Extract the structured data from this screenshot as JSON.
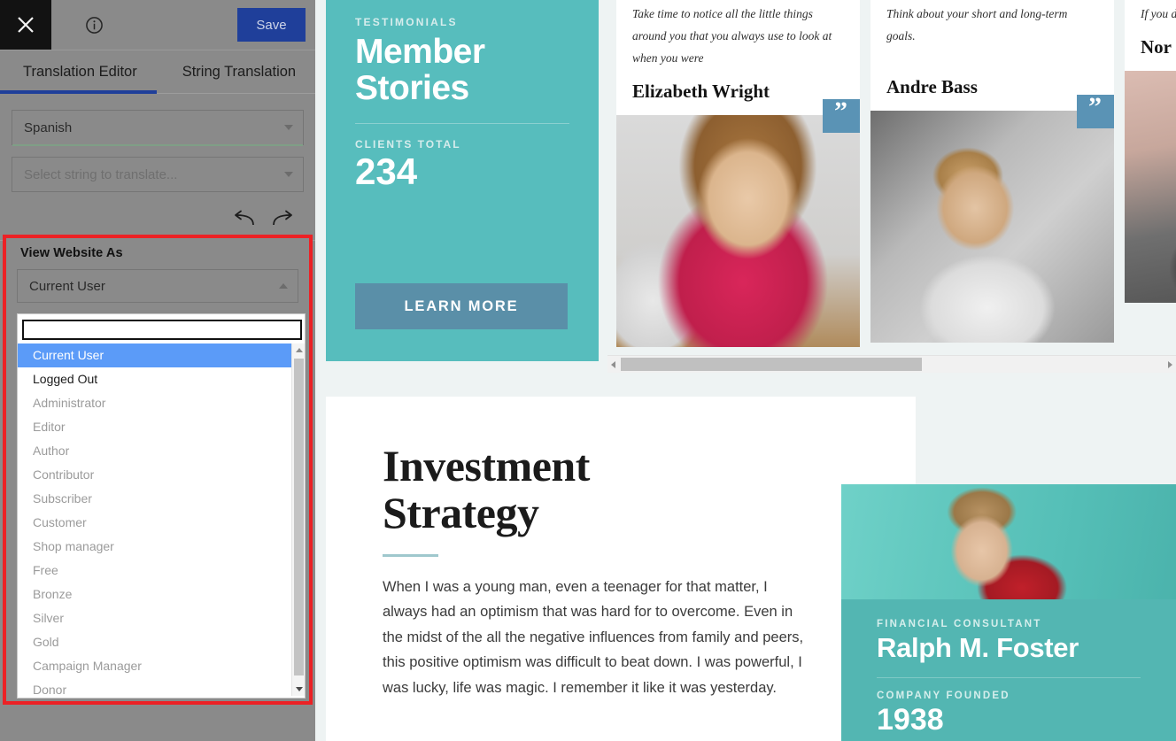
{
  "editor": {
    "close_icon": "close-icon",
    "info_icon": "info-icon",
    "save_label": "Save",
    "tabs": [
      {
        "label": "Translation Editor",
        "active": true
      },
      {
        "label": "String Translation",
        "active": false
      }
    ],
    "language_select": {
      "value": "Spanish"
    },
    "string_select": {
      "placeholder": "Select string to translate..."
    },
    "undo_icon": "undo-arrow-icon",
    "redo_icon": "redo-arrow-icon"
  },
  "view_website_as": {
    "label": "View Website As",
    "selected": "Current User",
    "search_value": "",
    "search_placeholder": "",
    "options": [
      {
        "label": "Current User",
        "state": "selected"
      },
      {
        "label": "Logged Out",
        "state": "active"
      },
      {
        "label": "Administrator",
        "state": "disabled"
      },
      {
        "label": "Editor",
        "state": "disabled"
      },
      {
        "label": "Author",
        "state": "disabled"
      },
      {
        "label": "Contributor",
        "state": "disabled"
      },
      {
        "label": "Subscriber",
        "state": "disabled"
      },
      {
        "label": "Customer",
        "state": "disabled"
      },
      {
        "label": "Shop manager",
        "state": "disabled"
      },
      {
        "label": "Free",
        "state": "disabled"
      },
      {
        "label": "Bronze",
        "state": "disabled"
      },
      {
        "label": "Silver",
        "state": "disabled"
      },
      {
        "label": "Gold",
        "state": "disabled"
      },
      {
        "label": "Campaign Manager",
        "state": "disabled"
      },
      {
        "label": "Donor",
        "state": "disabled"
      }
    ],
    "highlight_color": "#ec2125"
  },
  "site": {
    "hero": {
      "eyebrow": "TESTIMONIALS",
      "title_line1": "Member",
      "title_line2": "Stories",
      "stat_label": "CLIENTS TOTAL",
      "stat_value": "234",
      "button_label": "LEARN MORE",
      "accent_color": "#57bdbd",
      "button_color": "#5a8fa8"
    },
    "testimonials": [
      {
        "quote": "Take time to notice all the little things around you that you always use to look at when you were",
        "name": "Elizabeth Wright",
        "mark": "”"
      },
      {
        "quote": "Think about your short and long-term goals.",
        "name": "Andre Bass",
        "mark": "”"
      },
      {
        "quote": "If you day at you di",
        "name": "Nor",
        "mark": "”"
      }
    ],
    "scrollbar": {
      "left_arrow_icon": "chevron-left-icon",
      "right_arrow_icon": "chevron-right-icon"
    },
    "investment": {
      "title_line1": "Investment",
      "title_line2": "Strategy",
      "body": "When I was a young man, even a teenager for that matter, I always had an optimism that was hard for to overcome. Even in the midst of the all the negative influences from family and peers, this positive optimism was difficult to beat down. I was powerful, I was lucky, life was magic. I remember it like it was yesterday."
    },
    "consultant": {
      "role": "FINANCIAL CONSULTANT",
      "name": "Ralph M. Foster",
      "founded_label": "COMPANY FOUNDED",
      "founded_year": "1938",
      "accent_color": "#53b6b2"
    }
  }
}
